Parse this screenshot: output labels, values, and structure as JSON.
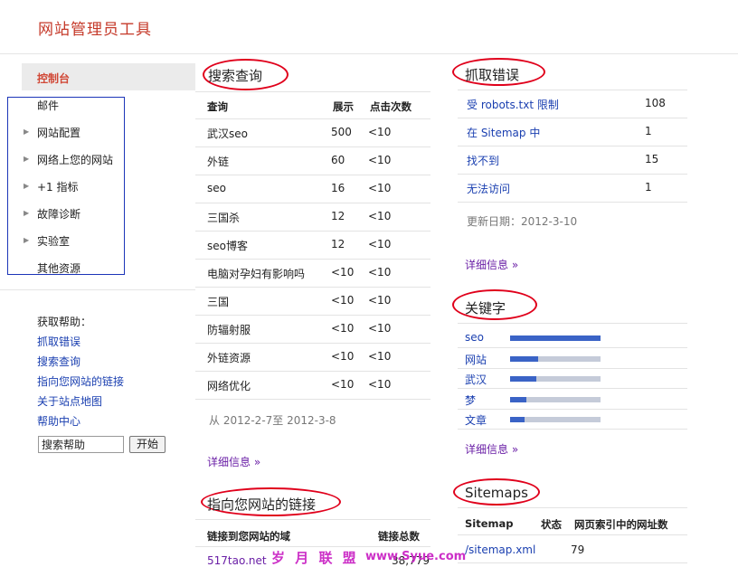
{
  "app": {
    "title": "网站管理员工具"
  },
  "sidebar": {
    "dashboard": "控制台",
    "items": [
      {
        "label": "邮件",
        "expandable": false
      },
      {
        "label": "网站配置",
        "expandable": true
      },
      {
        "label": "网络上您的网站",
        "expandable": true
      },
      {
        "label": "+1 指标",
        "expandable": true
      },
      {
        "label": "故障诊断",
        "expandable": true
      },
      {
        "label": "实验室",
        "expandable": true
      },
      {
        "label": "其他资源",
        "expandable": false
      }
    ],
    "help": {
      "heading": "获取帮助：",
      "links": [
        "抓取错误",
        "搜索查询",
        "指向您网站的链接",
        "关于站点地图",
        "帮助中心"
      ],
      "search_value": "搜索帮助",
      "search_button": "开始"
    }
  },
  "search_queries": {
    "title": "搜索查询",
    "headers": [
      "查询",
      "展示",
      "点击次数"
    ],
    "rows": [
      [
        "武汉seo",
        "500",
        "<10"
      ],
      [
        "外链",
        "60",
        "<10"
      ],
      [
        "seo",
        "16",
        "<10"
      ],
      [
        "三国杀",
        "12",
        "<10"
      ],
      [
        "seo博客",
        "12",
        "<10"
      ],
      [
        "电脑对孕妇有影响吗",
        "<10",
        "<10"
      ],
      [
        "三国",
        "<10",
        "<10"
      ],
      [
        "防辐射服",
        "<10",
        "<10"
      ],
      [
        "外链资源",
        "<10",
        "<10"
      ],
      [
        "网络优化",
        "<10",
        "<10"
      ]
    ],
    "date_range": "从 2012-2-7至 2012-3-8",
    "details": "详细信息 »"
  },
  "links_to_site": {
    "title": "指向您网站的链接",
    "headers": [
      "链接到您网站的域",
      "链接总数"
    ],
    "rows": [
      [
        "517tao.net",
        "38,779"
      ]
    ]
  },
  "crawl_errors": {
    "title": "抓取错误",
    "rows": [
      [
        "受 robots.txt 限制",
        "108"
      ],
      [
        "在 Sitemap 中",
        "1"
      ],
      [
        "找不到",
        "15"
      ],
      [
        "无法访问",
        "1"
      ]
    ],
    "updated": "更新日期：2012-3-10",
    "details": "详细信息 »"
  },
  "keywords": {
    "title": "关键字",
    "items": [
      {
        "label": "seo",
        "level": 1.0
      },
      {
        "label": "网站",
        "level": 0.31
      },
      {
        "label": "武汉",
        "level": 0.29
      },
      {
        "label": "梦",
        "level": 0.18
      },
      {
        "label": "文章",
        "level": 0.16
      }
    ],
    "details": "详细信息 »"
  },
  "sitemaps": {
    "title": "Sitemaps",
    "headers": [
      "Sitemap",
      "状态",
      "网页索引中的网址数"
    ],
    "rows": [
      [
        "/sitemap.xml",
        "",
        "79"
      ]
    ]
  },
  "watermark": {
    "text": "岁 月 联 盟",
    "url": "www.Syue.com"
  },
  "colors": {
    "accent_red": "#c53929",
    "link_blue": "#1a3fb0",
    "visited_purple": "#6a1fa6",
    "bar_blue": "#3a63c6",
    "bar_gray": "#c5cbd9",
    "annotation_red": "#e0001b",
    "annotation_box": "#1c35b8"
  }
}
